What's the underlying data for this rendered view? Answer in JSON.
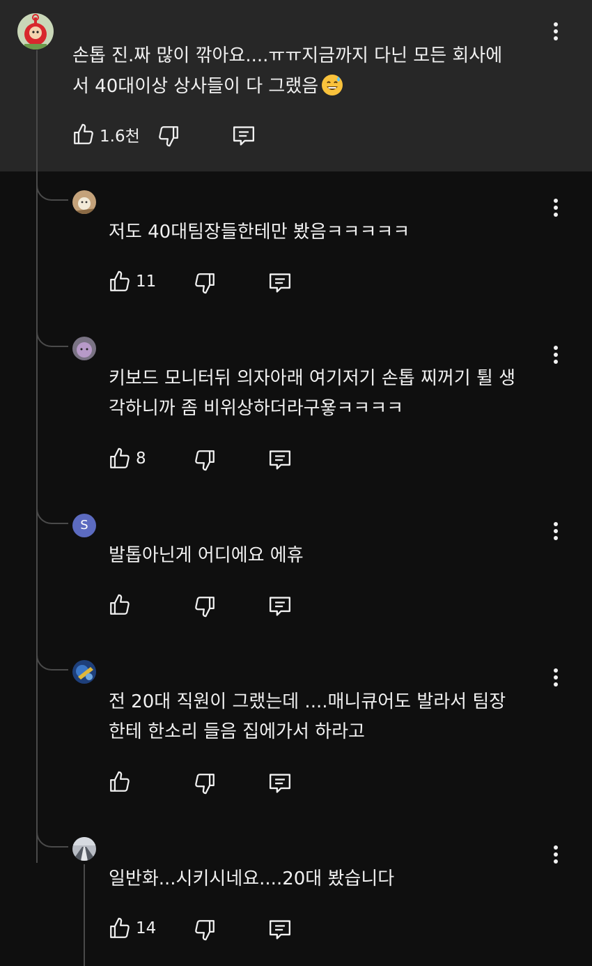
{
  "top_comment": {
    "lines": [
      "손톱 진.짜 많이 깎아요....ㅠㅠ지금까지 다닌 모든 회사에",
      "서 40대이상 상사들이 다 그랬음"
    ],
    "likes": "1.6천"
  },
  "replies": [
    {
      "lines": [
        "저도 40대팀장들한테만 봤음ㅋㅋㅋㅋㅋ"
      ],
      "likes": "11"
    },
    {
      "lines": [
        "키보드 모니터뒤 의자아래 여기저기 손톱 찌꺼기 튈 생",
        "각하니까 좀 비위상하더라구욯ㅋㅋㅋㅋ"
      ],
      "likes": "8"
    },
    {
      "lines": [
        "발톱아닌게 어디에요 에휴"
      ],
      "likes": "",
      "avatar_letter": "S"
    },
    {
      "lines": [
        "전 20대 직원이 그랬는데 ....매니큐어도 발라서 팀장",
        "한테 한소리 들음 집에가서 하라고"
      ],
      "likes": ""
    },
    {
      "lines": [
        "일반화...시키시네요....20대 봤습니다"
      ],
      "likes": "14"
    }
  ],
  "colors": {
    "panel": "#272727",
    "background": "#0f0f0f",
    "text": "#f1f1f1",
    "thread": "#4a4a4a",
    "letter_avatar": "#5c6bc0"
  }
}
